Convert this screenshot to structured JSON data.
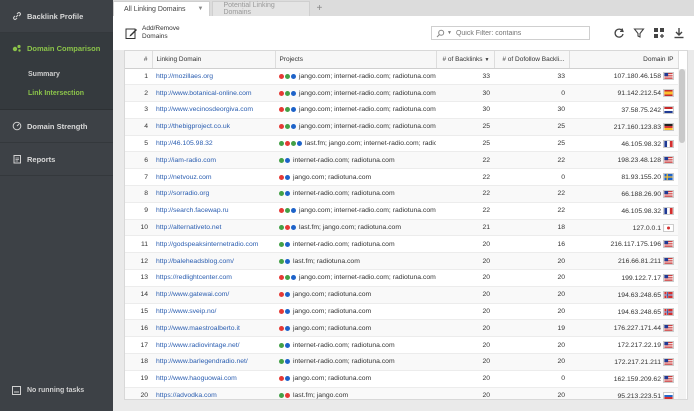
{
  "sidebar": {
    "items": [
      {
        "label": "Backlink Profile",
        "icon": "link-icon"
      },
      {
        "label": "Domain Comparison",
        "icon": "compare-icon"
      },
      {
        "label": "Domain Strength",
        "icon": "gauge-icon"
      },
      {
        "label": "Reports",
        "icon": "report-icon"
      }
    ],
    "subitems": [
      {
        "label": "Summary"
      },
      {
        "label": "Link Intersection"
      }
    ],
    "bottom": "No running tasks"
  },
  "tabs": {
    "active": "All Linking Domains",
    "inactive": "Potential Linking Domains",
    "add": "+"
  },
  "toolbar": {
    "add_remove_label": "Add/Remove Domains",
    "quick_filter_placeholder": "Quick Filter: contains"
  },
  "table": {
    "headers": {
      "num": "#",
      "domain": "Linking Domain",
      "projects": "Projects",
      "backlinks": "# of Backlinks",
      "dofollow": "# of Dofollow Backli...",
      "ip": "Domain IP"
    },
    "rows": [
      {
        "n": "1",
        "domain": "http://mozillaes.org",
        "dots": [
          "#e53935",
          "#43a047",
          "#1e63c9"
        ],
        "projects": "jango.com; internet-radio.com; radiotuna.com",
        "backlinks": "33",
        "dofollow": "33",
        "ip": "107.180.46.158",
        "flag": "us"
      },
      {
        "n": "2",
        "domain": "http://www.botanical-online.com",
        "dots": [
          "#e53935",
          "#43a047",
          "#1e63c9"
        ],
        "projects": "jango.com; internet-radio.com; radiotuna.com",
        "backlinks": "30",
        "dofollow": "0",
        "ip": "91.142.212.54",
        "flag": "es"
      },
      {
        "n": "3",
        "domain": "http://www.vecinosdeorgiva.com",
        "dots": [
          "#e53935",
          "#43a047",
          "#1e63c9"
        ],
        "projects": "jango.com; internet-radio.com; radiotuna.com",
        "backlinks": "30",
        "dofollow": "30",
        "ip": "37.58.75.242",
        "flag": "nl"
      },
      {
        "n": "4",
        "domain": "http://thebigproject.co.uk",
        "dots": [
          "#e53935",
          "#43a047",
          "#1e63c9"
        ],
        "projects": "jango.com; internet-radio.com; radiotuna.com",
        "backlinks": "25",
        "dofollow": "25",
        "ip": "217.160.123.83",
        "flag": "de"
      },
      {
        "n": "5",
        "domain": "http://46.105.98.32",
        "dots": [
          "#43a047",
          "#e53935",
          "#43a047",
          "#1e63c9"
        ],
        "projects": "last.fm; jango.com; internet-radio.com; radiotuna.c...",
        "backlinks": "25",
        "dofollow": "25",
        "ip": "46.105.98.32",
        "flag": "fr"
      },
      {
        "n": "6",
        "domain": "http://iam-radio.com",
        "dots": [
          "#43a047",
          "#1e63c9"
        ],
        "projects": "internet-radio.com; radiotuna.com",
        "backlinks": "22",
        "dofollow": "22",
        "ip": "198.23.48.128",
        "flag": "us"
      },
      {
        "n": "7",
        "domain": "http://netvouz.com",
        "dots": [
          "#e53935",
          "#1e63c9"
        ],
        "projects": "jango.com; radiotuna.com",
        "backlinks": "22",
        "dofollow": "0",
        "ip": "81.93.155.20",
        "flag": "se"
      },
      {
        "n": "8",
        "domain": "http://sorradio.org",
        "dots": [
          "#43a047",
          "#1e63c9"
        ],
        "projects": "internet-radio.com; radiotuna.com",
        "backlinks": "22",
        "dofollow": "22",
        "ip": "66.188.26.90",
        "flag": "us"
      },
      {
        "n": "9",
        "domain": "http://search.facewap.ru",
        "dots": [
          "#e53935",
          "#43a047",
          "#1e63c9"
        ],
        "projects": "jango.com; internet-radio.com; radiotuna.com",
        "backlinks": "22",
        "dofollow": "22",
        "ip": "46.105.98.32",
        "flag": "fr"
      },
      {
        "n": "10",
        "domain": "http://alternativeto.net",
        "dots": [
          "#43a047",
          "#e53935",
          "#1e63c9"
        ],
        "projects": "last.fm; jango.com; radiotuna.com",
        "backlinks": "21",
        "dofollow": "18",
        "ip": "127.0.0.1",
        "flag": "jp"
      },
      {
        "n": "11",
        "domain": "http://godspeaksinternetradio.com",
        "dots": [
          "#43a047",
          "#1e63c9"
        ],
        "projects": "internet-radio.com; radiotuna.com",
        "backlinks": "20",
        "dofollow": "16",
        "ip": "216.117.175.196",
        "flag": "us"
      },
      {
        "n": "12",
        "domain": "http://baleheadsblog.com/",
        "dots": [
          "#43a047",
          "#1e63c9"
        ],
        "projects": "last.fm; radiotuna.com",
        "backlinks": "20",
        "dofollow": "20",
        "ip": "216.66.81.211",
        "flag": "us"
      },
      {
        "n": "13",
        "domain": "https://redlightcenter.com",
        "dots": [
          "#e53935",
          "#43a047",
          "#1e63c9"
        ],
        "projects": "jango.com; internet-radio.com; radiotuna.com",
        "backlinks": "20",
        "dofollow": "20",
        "ip": "199.122.7.17",
        "flag": "us"
      },
      {
        "n": "14",
        "domain": "http://www.gatewai.com/",
        "dots": [
          "#e53935",
          "#1e63c9"
        ],
        "projects": "jango.com; radiotuna.com",
        "backlinks": "20",
        "dofollow": "20",
        "ip": "194.63.248.65",
        "flag": "no"
      },
      {
        "n": "15",
        "domain": "http://www.sveip.no/",
        "dots": [
          "#e53935",
          "#1e63c9"
        ],
        "projects": "jango.com; radiotuna.com",
        "backlinks": "20",
        "dofollow": "20",
        "ip": "194.63.248.65",
        "flag": "no"
      },
      {
        "n": "16",
        "domain": "http://www.maestroalberto.it",
        "dots": [
          "#e53935",
          "#1e63c9"
        ],
        "projects": "jango.com; radiotuna.com",
        "backlinks": "20",
        "dofollow": "19",
        "ip": "176.227.171.44",
        "flag": "us"
      },
      {
        "n": "17",
        "domain": "http://www.radiovintage.net/",
        "dots": [
          "#43a047",
          "#1e63c9"
        ],
        "projects": "internet-radio.com; radiotuna.com",
        "backlinks": "20",
        "dofollow": "20",
        "ip": "172.217.22.19",
        "flag": "us"
      },
      {
        "n": "18",
        "domain": "http://www.barlegendradio.net/",
        "dots": [
          "#43a047",
          "#1e63c9"
        ],
        "projects": "internet-radio.com; radiotuna.com",
        "backlinks": "20",
        "dofollow": "20",
        "ip": "172.217.21.211",
        "flag": "us"
      },
      {
        "n": "19",
        "domain": "http://www.haoguowai.com",
        "dots": [
          "#e53935",
          "#1e63c9"
        ],
        "projects": "jango.com; radiotuna.com",
        "backlinks": "20",
        "dofollow": "0",
        "ip": "162.159.209.62",
        "flag": "us"
      },
      {
        "n": "20",
        "domain": "https://advodka.com",
        "dots": [
          "#43a047",
          "#e53935"
        ],
        "projects": "last.fm; jango.com",
        "backlinks": "20",
        "dofollow": "20",
        "ip": "95.213.223.51",
        "flag": "ru"
      }
    ]
  }
}
